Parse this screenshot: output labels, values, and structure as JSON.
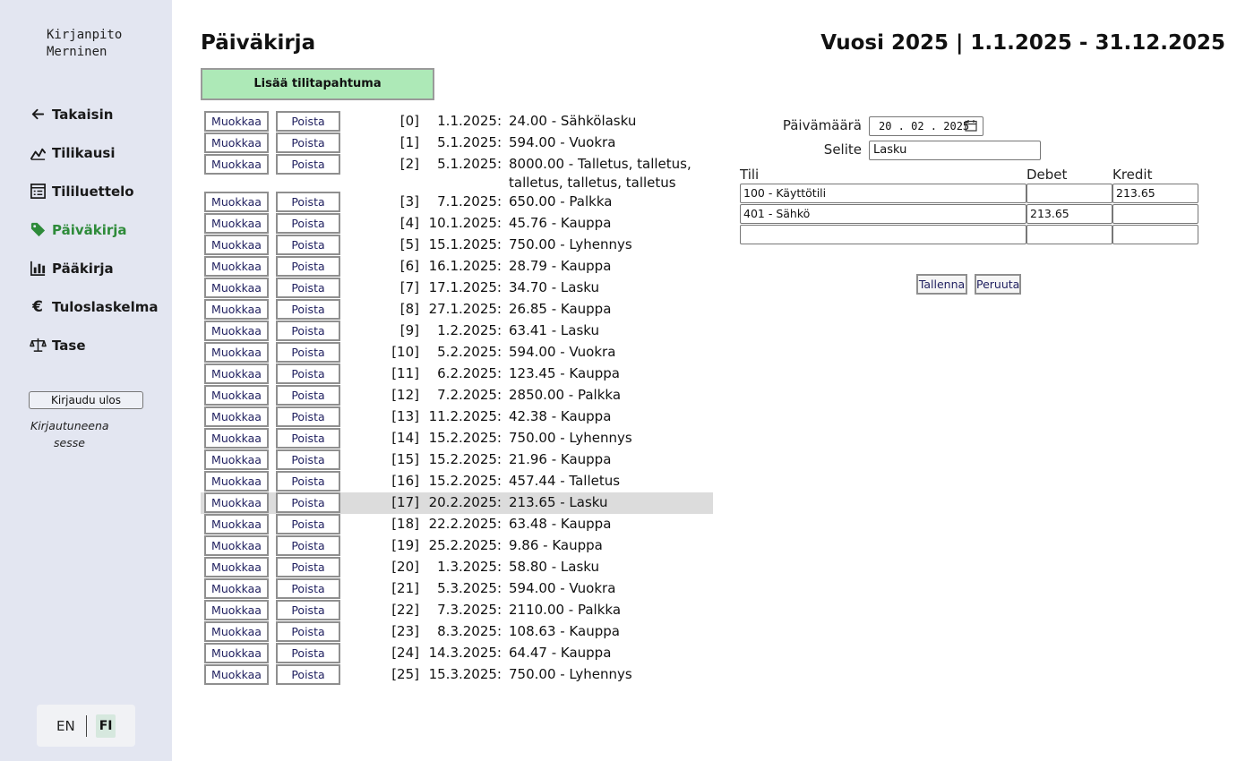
{
  "sidebar": {
    "brand_line1": "Kirjanpito",
    "brand_line2": "Merninen",
    "items": [
      {
        "label": "Takaisin",
        "icon": "arrow-left-icon"
      },
      {
        "label": "Tilikausi",
        "icon": "chart-line-icon"
      },
      {
        "label": "Tililuettelo",
        "icon": "list-icon"
      },
      {
        "label": "Päiväkirja",
        "icon": "tag-icon",
        "active": true
      },
      {
        "label": "Pääkirja",
        "icon": "bar-chart-icon"
      },
      {
        "label": "Tuloslaskelma",
        "icon": "euro-icon"
      },
      {
        "label": "Tase",
        "icon": "scale-icon"
      }
    ],
    "logout_label": "Kirjaudu ulos",
    "logged_in_label": "Kirjautuneena",
    "username": "sesse",
    "lang_en": "EN",
    "lang_fi": "FI",
    "active_color": "#2e8b3a"
  },
  "header": {
    "title": "Päiväkirja",
    "period": "Vuosi 2025 | 1.1.2025 - 31.12.2025",
    "add_button": "Lisää tilitapahtuma"
  },
  "entry_buttons": {
    "edit": "Muokkaa",
    "delete": "Poista"
  },
  "entries": [
    {
      "idx": "[0]",
      "date": "1.1.2025:",
      "desc": "24.00 - Sähkölasku"
    },
    {
      "idx": "[1]",
      "date": "5.1.2025:",
      "desc": "594.00 - Vuokra"
    },
    {
      "idx": "[2]",
      "date": "5.1.2025:",
      "desc": "8000.00 - Talletus, talletus, talletus, talletus, talletus"
    },
    {
      "idx": "[3]",
      "date": "7.1.2025:",
      "desc": "650.00 - Palkka"
    },
    {
      "idx": "[4]",
      "date": "10.1.2025:",
      "desc": "45.76 - Kauppa"
    },
    {
      "idx": "[5]",
      "date": "15.1.2025:",
      "desc": "750.00 - Lyhennys"
    },
    {
      "idx": "[6]",
      "date": "16.1.2025:",
      "desc": "28.79 - Kauppa"
    },
    {
      "idx": "[7]",
      "date": "17.1.2025:",
      "desc": "34.70 - Lasku"
    },
    {
      "idx": "[8]",
      "date": "27.1.2025:",
      "desc": "26.85 - Kauppa"
    },
    {
      "idx": "[9]",
      "date": "1.2.2025:",
      "desc": "63.41 - Lasku"
    },
    {
      "idx": "[10]",
      "date": "5.2.2025:",
      "desc": "594.00 - Vuokra"
    },
    {
      "idx": "[11]",
      "date": "6.2.2025:",
      "desc": "123.45 - Kauppa"
    },
    {
      "idx": "[12]",
      "date": "7.2.2025:",
      "desc": "2850.00 - Palkka"
    },
    {
      "idx": "[13]",
      "date": "11.2.2025:",
      "desc": "42.38 - Kauppa"
    },
    {
      "idx": "[14]",
      "date": "15.2.2025:",
      "desc": "750.00 - Lyhennys"
    },
    {
      "idx": "[15]",
      "date": "15.2.2025:",
      "desc": "21.96 - Kauppa"
    },
    {
      "idx": "[16]",
      "date": "15.2.2025:",
      "desc": "457.44 - Talletus"
    },
    {
      "idx": "[17]",
      "date": "20.2.2025:",
      "desc": "213.65 - Lasku",
      "selected": true
    },
    {
      "idx": "[18]",
      "date": "22.2.2025:",
      "desc": "63.48 - Kauppa"
    },
    {
      "idx": "[19]",
      "date": "25.2.2025:",
      "desc": "9.86 - Kauppa"
    },
    {
      "idx": "[20]",
      "date": "1.3.2025:",
      "desc": "58.80 - Lasku"
    },
    {
      "idx": "[21]",
      "date": "5.3.2025:",
      "desc": "594.00 - Vuokra"
    },
    {
      "idx": "[22]",
      "date": "7.3.2025:",
      "desc": "2110.00 - Palkka"
    },
    {
      "idx": "[23]",
      "date": "8.3.2025:",
      "desc": "108.63 - Kauppa"
    },
    {
      "idx": "[24]",
      "date": "14.3.2025:",
      "desc": "64.47 - Kauppa"
    },
    {
      "idx": "[25]",
      "date": "15.3.2025:",
      "desc": "750.00 - Lyhennys"
    }
  ],
  "form": {
    "date_label": "Päivämäärä",
    "date_value": "20 . 02 . 2025",
    "desc_label": "Selite",
    "desc_value": "Lasku",
    "col_account": "Tili",
    "col_debit": "Debet",
    "col_credit": "Kredit",
    "rows": [
      {
        "account": "100 - Käyttötili",
        "debit": "",
        "credit": "213.65"
      },
      {
        "account": "401 - Sähkö",
        "debit": "213.65",
        "credit": ""
      },
      {
        "account": "",
        "debit": "",
        "credit": ""
      }
    ],
    "save_label": "Tallenna",
    "cancel_label": "Peruuta"
  }
}
